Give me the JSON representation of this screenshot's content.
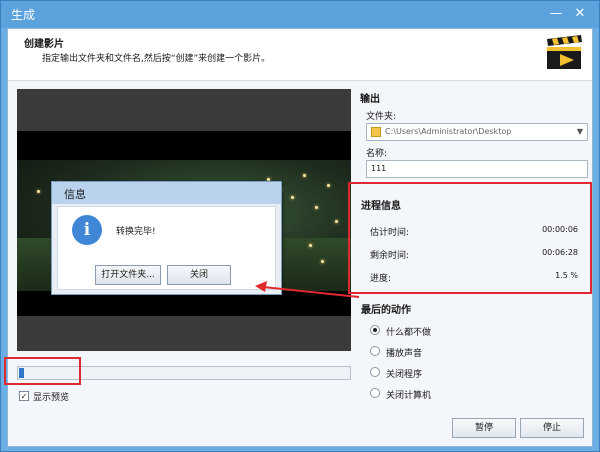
{
  "window": {
    "title": "生成",
    "minimize": "—",
    "close": "✕"
  },
  "header": {
    "title": "创建影片",
    "subtitle": "指定输出文件夹和文件名,然后按“创建”来创建一个影片。",
    "icon": "clapperboard-icon"
  },
  "output": {
    "section": "输出",
    "folder_label": "文件夹:",
    "folder_value": "C:\\Users\\Administrator\\Desktop",
    "name_label": "名称:",
    "name_value": "111"
  },
  "progress_info": {
    "section": "进程信息",
    "rows": [
      {
        "label": "估计时间:",
        "value": "00:00:06"
      },
      {
        "label": "剩余时间:",
        "value": "00:06:28"
      },
      {
        "label": "进度:",
        "value": "1.5 %"
      }
    ]
  },
  "final_action": {
    "section": "最后的动作",
    "options": [
      {
        "label": "什么都不做",
        "selected": true
      },
      {
        "label": "播放声音",
        "selected": false
      },
      {
        "label": "关闭程序",
        "selected": false
      },
      {
        "label": "关闭计算机",
        "selected": false
      }
    ]
  },
  "preview": {
    "show_label": "显示预览",
    "checked": true,
    "progress_fraction": 0.015
  },
  "info_dialog": {
    "title": "信息",
    "message": "转换完毕!",
    "open_folder_label": "打开文件夹...",
    "close_label": "关闭",
    "icon": "info-icon"
  },
  "buttons": {
    "pause_label": "暂停",
    "stop_label": "停止"
  },
  "colors": {
    "titlebar": "#5ca3dd",
    "highlight": "#e0282f",
    "progress": "#2f75c8"
  }
}
